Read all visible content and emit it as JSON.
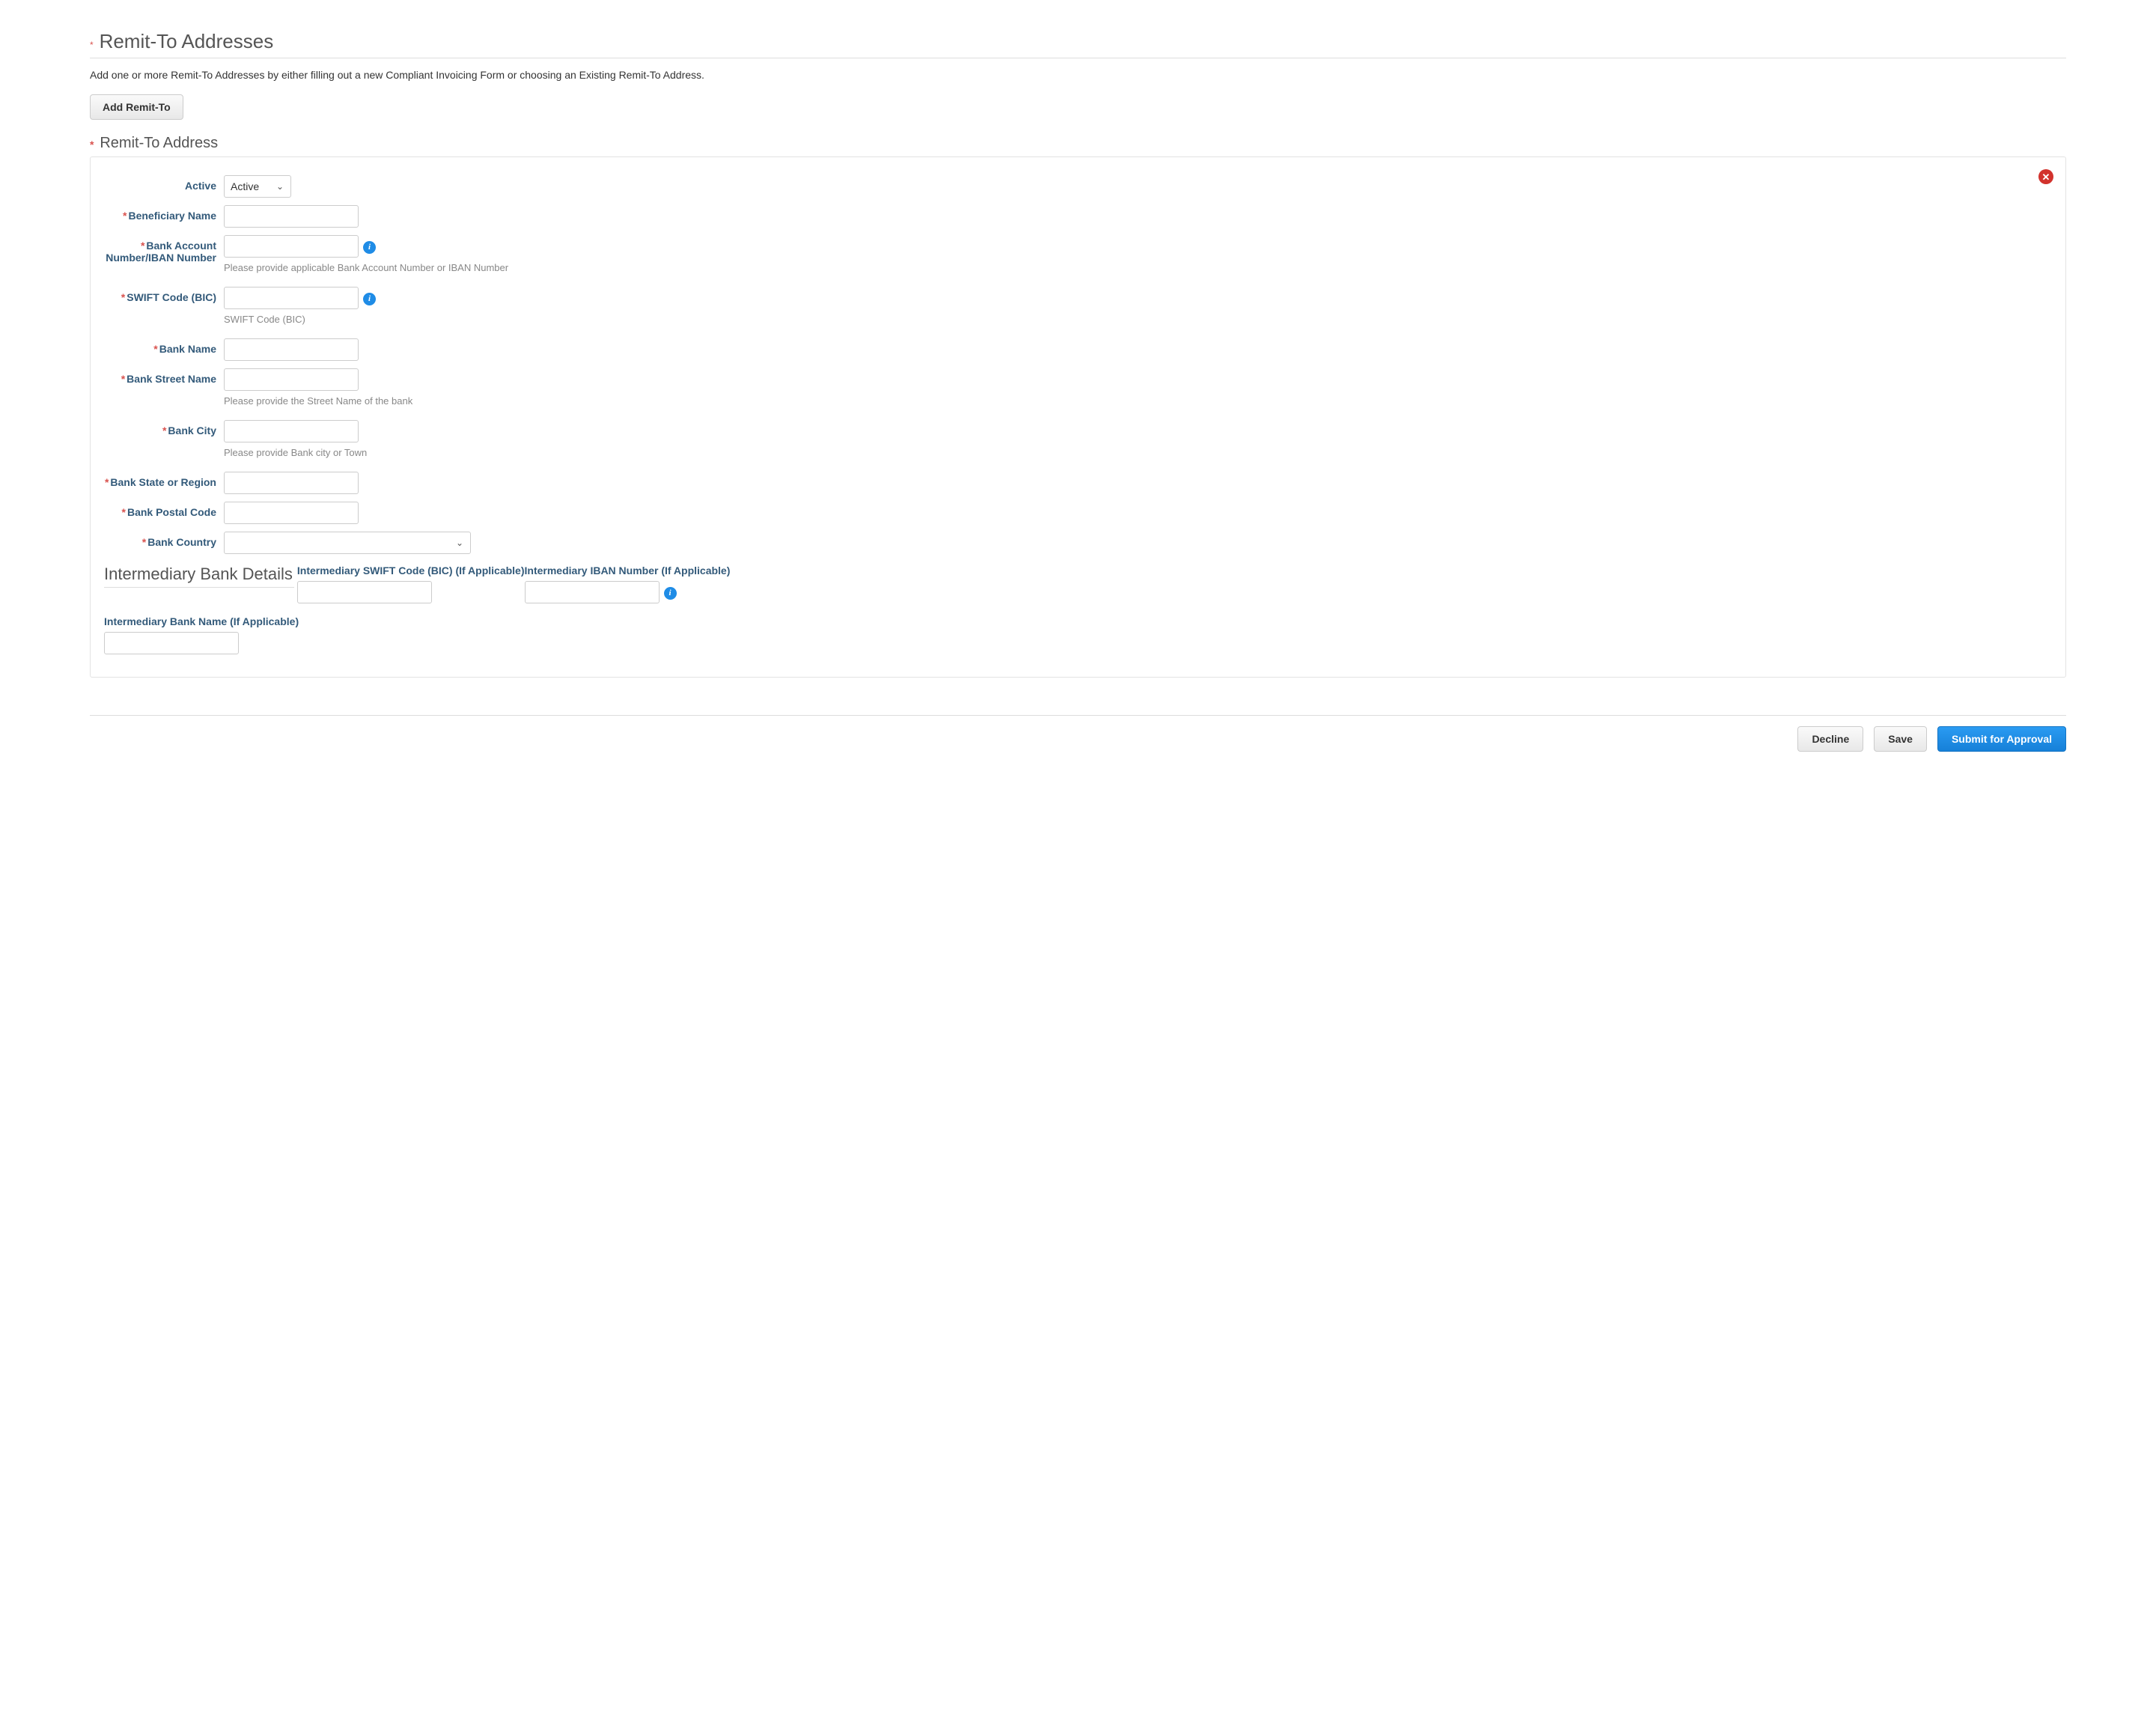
{
  "header": {
    "title": "Remit-To Addresses",
    "instruction": "Add one or more Remit-To Addresses by either filling out a new Compliant Invoicing Form or choosing an Existing Remit-To Address.",
    "add_button": "Add Remit-To"
  },
  "section": {
    "title": "Remit-To Address"
  },
  "form": {
    "active_label": "Active",
    "active_value": "Active",
    "beneficiary_name_label": "Beneficiary Name",
    "bank_account_label": "Bank Account Number/IBAN Number",
    "bank_account_hint": "Please provide applicable Bank Account Number or IBAN Number",
    "swift_label": "SWIFT Code (BIC)",
    "swift_hint": "SWIFT Code (BIC)",
    "bank_name_label": "Bank Name",
    "bank_street_label": "Bank Street Name",
    "bank_street_hint": "Please provide the Street Name of the bank",
    "bank_city_label": "Bank City",
    "bank_city_hint": "Please provide Bank city or Town",
    "bank_state_label": "Bank State or Region",
    "bank_postal_label": "Bank Postal Code",
    "bank_country_label": "Bank Country"
  },
  "intermediary": {
    "title": "Intermediary Bank Details",
    "swift_label": "Intermediary SWIFT Code (BIC) (If Applicable)",
    "iban_label": "Intermediary IBAN Number (If Applicable)",
    "bank_name_label": "Intermediary Bank Name (If Applicable)"
  },
  "actions": {
    "decline": "Decline",
    "save": "Save",
    "submit": "Submit for Approval"
  }
}
